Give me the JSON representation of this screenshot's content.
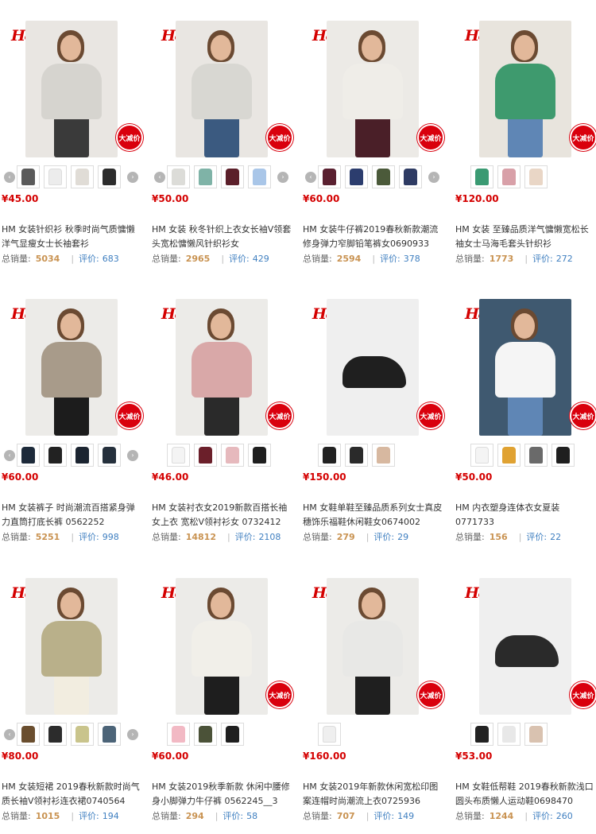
{
  "brand_logo": "H&M",
  "badge_text": "大减价",
  "arrows": {
    "left": "‹",
    "right": "›"
  },
  "stats_labels": {
    "sales": "总销量:",
    "reviews_prefix": "评价:"
  },
  "colors": {
    "price": "#d40000",
    "badge": "#d9000d",
    "sales_count": "#c99352",
    "reviews": "#3f7fc0"
  },
  "products": [
    {
      "price": "¥45.00",
      "title": "HM 女装针织衫 秋季时尚气质慵懒洋气显瘦女士长袖套衫",
      "sales": "5034",
      "reviews": "683",
      "has_badge": true,
      "has_arrows": true,
      "thumb_colors": [
        "#5a5a5a",
        "#ececec",
        "#e0dcd6",
        "#2c2c2c"
      ],
      "photo": {
        "bg": "#e9e6e2",
        "top": "#d6d4cf",
        "bottom": "#3a3a3a",
        "type": "model"
      }
    },
    {
      "price": "¥50.00",
      "title": "HM 女装 秋冬针织上衣女长袖V领套头宽松慵懒风针织衫女",
      "sales": "2965",
      "reviews": "429",
      "has_badge": true,
      "has_arrows": true,
      "thumb_colors": [
        "#dcdcd8",
        "#7fb3a7",
        "#5b1f2a",
        "#a9c6e8"
      ],
      "photo": {
        "bg": "#e9e6e2",
        "top": "#d8d7d2",
        "bottom": "#3b5a80",
        "type": "model"
      }
    },
    {
      "price": "¥60.00",
      "title": "HM 女装牛仔裤2019春秋新款潮流修身弹力窄脚铅笔裤女0690933",
      "sales": "2594",
      "reviews": "378",
      "has_badge": true,
      "has_arrows": true,
      "thumb_colors": [
        "#5a2030",
        "#2c3d6e",
        "#4b5a3a",
        "#2e3b63"
      ],
      "photo": {
        "bg": "#eceae6",
        "top": "#efede8",
        "bottom": "#4a1f28",
        "type": "model"
      }
    },
    {
      "price": "¥120.00",
      "title": "HM 女装 至臻品质洋气慵懒宽松长袖女士马海毛套头针织衫",
      "sales": "1773",
      "reviews": "272",
      "has_badge": true,
      "has_arrows": false,
      "thumb_colors": [
        "#3a9a72",
        "#d8a0a8",
        "#e9d6c6"
      ],
      "photo": {
        "bg": "#e8e4dd",
        "top": "#3e9a6e",
        "bottom": "#5f86b5",
        "type": "model"
      }
    },
    {
      "price": "¥60.00",
      "title": "HM 女装裤子 时尚潮流百搭紧身弹力直筒打底长裤 0562252",
      "sales": "5251",
      "reviews": "998",
      "has_badge": true,
      "has_arrows": true,
      "thumb_colors": [
        "#1d2a3a",
        "#222222",
        "#1b2430",
        "#25303c"
      ],
      "photo": {
        "bg": "#ecebe8",
        "top": "#a89b8a",
        "bottom": "#1c1c1c",
        "type": "model"
      }
    },
    {
      "price": "¥46.00",
      "title": "HM 女装衬衣女2019新款百搭长袖女上衣 宽松V领衬衫女 0732412",
      "sales": "14812",
      "reviews": "2108",
      "has_badge": true,
      "has_arrows": false,
      "thumb_colors": [
        "#f4f4f4",
        "#6b1f2a",
        "#e6b9bd",
        "#1f1f1f"
      ],
      "photo": {
        "bg": "#ecebe8",
        "top": "#d9a8a8",
        "bottom": "#2a2a2a",
        "type": "model"
      }
    },
    {
      "price": "¥150.00",
      "title": "HM 女鞋单鞋至臻品质系列女士真皮穗饰乐福鞋休闲鞋女0674002",
      "sales": "279",
      "reviews": "29",
      "has_badge": true,
      "has_arrows": false,
      "thumb_colors": [
        "#222222",
        "#2a2a2a",
        "#d7b8a0"
      ],
      "photo": {
        "bg": "#efefef",
        "top": "#1f1f1f",
        "bottom": "#1f1f1f",
        "type": "shoe"
      }
    },
    {
      "price": "¥50.00",
      "title": "HM 内衣塑身连体衣女夏装 0771733",
      "sales": "156",
      "reviews": "22",
      "has_badge": true,
      "has_arrows": false,
      "thumb_colors": [
        "#f4f4f4",
        "#e0a232",
        "#6a6a6a",
        "#1f1f1f"
      ],
      "photo": {
        "bg": "#3f5970",
        "top": "#f5f5f5",
        "bottom": "#5f86b5",
        "type": "model"
      }
    },
    {
      "price": "¥80.00",
      "title": "HM 女装短裙 2019春秋新款时尚气质长袖V领衬衫连衣裙0740564",
      "sales": "1015",
      "reviews": "194",
      "has_badge": false,
      "has_arrows": true,
      "thumb_colors": [
        "#6a4e2e",
        "#2c2c2c",
        "#c9c48c",
        "#4c6478"
      ],
      "photo": {
        "bg": "#ecebe8",
        "top": "#b9b08a",
        "bottom": "#f2ede0",
        "type": "model"
      }
    },
    {
      "price": "¥60.00",
      "title": "HM 女装2019秋季新款 休闲中腰修身小脚弹力牛仔裤 0562245__3",
      "sales": "294",
      "reviews": "58",
      "has_badge": true,
      "has_arrows": false,
      "thumb_colors": [
        "#f2b9c4",
        "#4b5238",
        "#1f1f1f"
      ],
      "photo": {
        "bg": "#ecebe8",
        "top": "#f1efe9",
        "bottom": "#1e1e1e",
        "type": "model"
      }
    },
    {
      "price": "¥160.00",
      "title": "HM 女装2019年新款休闲宽松印图案连帽时尚潮流上衣0725936",
      "sales": "707",
      "reviews": "149",
      "has_badge": true,
      "has_arrows": false,
      "thumb_colors": [
        "#efefef"
      ],
      "photo": {
        "bg": "#ecebe8",
        "top": "#e8e8e6",
        "bottom": "#1f1f1f",
        "type": "model"
      }
    },
    {
      "price": "¥53.00",
      "title": "HM 女鞋低帮鞋 2019春秋新款浅口圆头布质懒人运动鞋0698470",
      "sales": "1244",
      "reviews": "260",
      "has_badge": true,
      "has_arrows": false,
      "thumb_colors": [
        "#222222",
        "#e8e8e8",
        "#d9c2b0"
      ],
      "photo": {
        "bg": "#efefef",
        "top": "#2a2a2a",
        "bottom": "#2a2a2a",
        "type": "shoe"
      }
    }
  ]
}
